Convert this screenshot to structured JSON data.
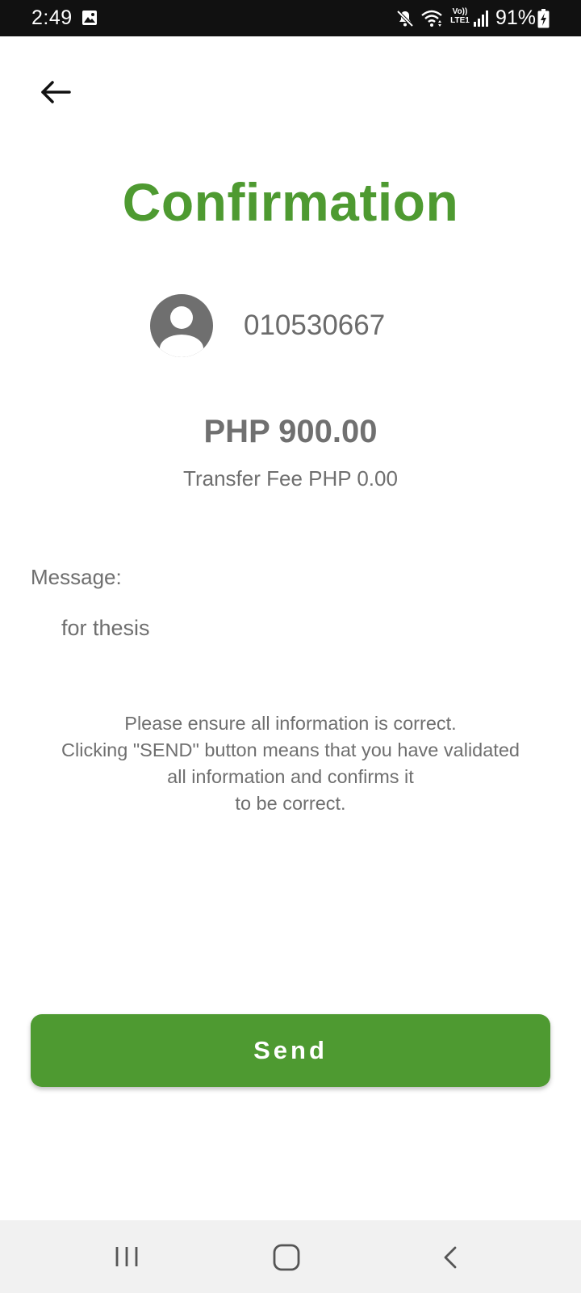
{
  "status_bar": {
    "time": "2:49",
    "battery_percent": "91%",
    "network_label": "Vo))\nLTE1",
    "icons": [
      "gallery-icon",
      "mute-icon",
      "wifi-icon",
      "volte-icon",
      "signal-icon",
      "battery-charging-icon"
    ]
  },
  "header": {
    "back_icon": "arrow-left-icon",
    "title": "Confirmation"
  },
  "recipient": {
    "avatar_icon": "person-avatar-icon",
    "account_number": "010530667"
  },
  "transfer": {
    "amount": "PHP 900.00",
    "fee": "Transfer Fee PHP 0.00"
  },
  "message": {
    "label": "Message:",
    "value": "for thesis"
  },
  "notice": {
    "line1": "Please ensure all information is correct.",
    "line2": "Clicking \"SEND\" button means that you have validated",
    "line3": "all information and confirms it",
    "line4": "to be correct."
  },
  "actions": {
    "send_label": "Send"
  },
  "nav_bar": {
    "icons": [
      "recents-icon",
      "home-icon",
      "back-icon"
    ]
  },
  "colors": {
    "accent": "#4e9a31",
    "text_gray": "#6f6f6f",
    "status_bar_bg": "#111111",
    "nav_bar_bg": "#f1f1f1"
  }
}
